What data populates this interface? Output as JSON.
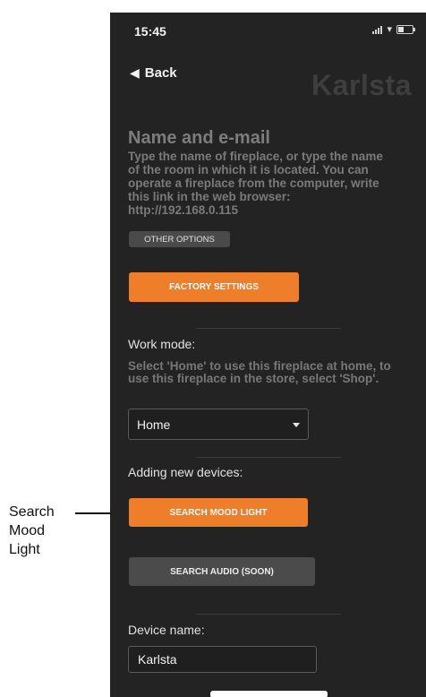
{
  "annotation": {
    "label": "Search\nMood\nLight"
  },
  "status_bar": {
    "time": "15:45"
  },
  "nav": {
    "back_label": "Back",
    "brand": "Karlsta"
  },
  "section": {
    "title": "Name and e-mail",
    "description": "Type the name of fireplace, or type the name of the room in which it is located. You can operate a fireplace from the computer, write this link in the web browser: http://192.168.0.115"
  },
  "buttons": {
    "other_options": "OTHER OPTIONS",
    "factory_settings": "FACTORY SETTINGS",
    "search_mood_light": "SEARCH MOOD LIGHT",
    "search_audio": "SEARCH AUDIO (SOON)"
  },
  "work_mode": {
    "label": "Work mode:",
    "help": "Select 'Home' to use this fireplace at home, to use this fireplace in the store, select 'Shop'.",
    "selected": "Home"
  },
  "devices": {
    "label": "Adding new devices:"
  },
  "device_name": {
    "label": "Device name:",
    "value": "Karlsta"
  },
  "colors": {
    "accent": "#ee7e29",
    "background": "#232323",
    "secondary_button": "#4b4b4b"
  },
  "icons": {
    "back": "home-arrow-icon",
    "signal": "signal-icon",
    "wifi": "wifi-icon",
    "battery": "battery-icon",
    "dropdown": "caret-down-icon"
  }
}
